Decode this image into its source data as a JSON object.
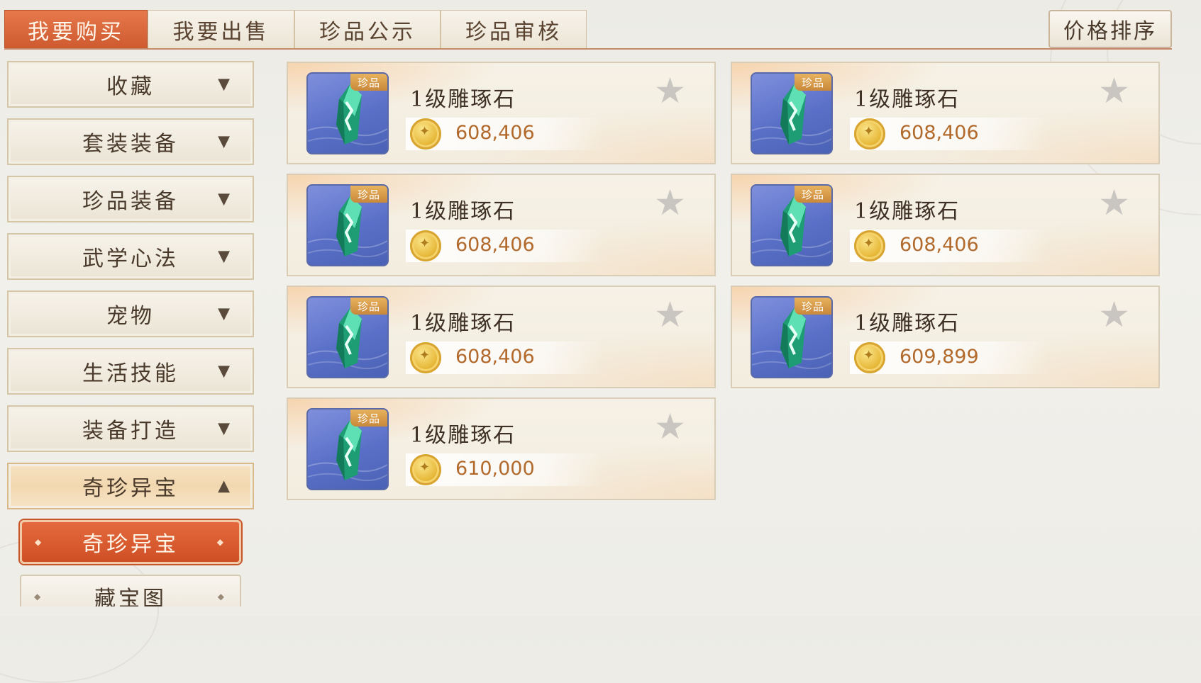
{
  "tabs": [
    {
      "label": "我要购买",
      "active": true
    },
    {
      "label": "我要出售",
      "active": false
    },
    {
      "label": "珍品公示",
      "active": false
    },
    {
      "label": "珍品审核",
      "active": false
    }
  ],
  "sort_button": "价格排序",
  "sidebar": {
    "categories": [
      {
        "label": "收藏",
        "arrow": "▼"
      },
      {
        "label": "套装装备",
        "arrow": "▼"
      },
      {
        "label": "珍品装备",
        "arrow": "▼"
      },
      {
        "label": "武学心法",
        "arrow": "▼"
      },
      {
        "label": "宠物",
        "arrow": "▼"
      },
      {
        "label": "生活技能",
        "arrow": "▼"
      },
      {
        "label": "装备打造",
        "arrow": "▼"
      },
      {
        "label": "奇珍异宝",
        "arrow": "▲"
      }
    ],
    "subitems": [
      {
        "label": "奇珍异宝",
        "active": true
      },
      {
        "label": "藏宝图",
        "active": false
      }
    ]
  },
  "items": [
    {
      "name": "1级雕琢石",
      "price": "608,406",
      "badge": "珍品"
    },
    {
      "name": "1级雕琢石",
      "price": "608,406",
      "badge": "珍品"
    },
    {
      "name": "1级雕琢石",
      "price": "608,406",
      "badge": "珍品"
    },
    {
      "name": "1级雕琢石",
      "price": "608,406",
      "badge": "珍品"
    },
    {
      "name": "1级雕琢石",
      "price": "608,406",
      "badge": "珍品"
    },
    {
      "name": "1级雕琢石",
      "price": "609,899",
      "badge": "珍品"
    },
    {
      "name": "1级雕琢石",
      "price": "610,000",
      "badge": "珍品"
    }
  ],
  "colors": {
    "accent": "#d9633a",
    "price": "#b26a2c",
    "badge": "#d99a48"
  }
}
